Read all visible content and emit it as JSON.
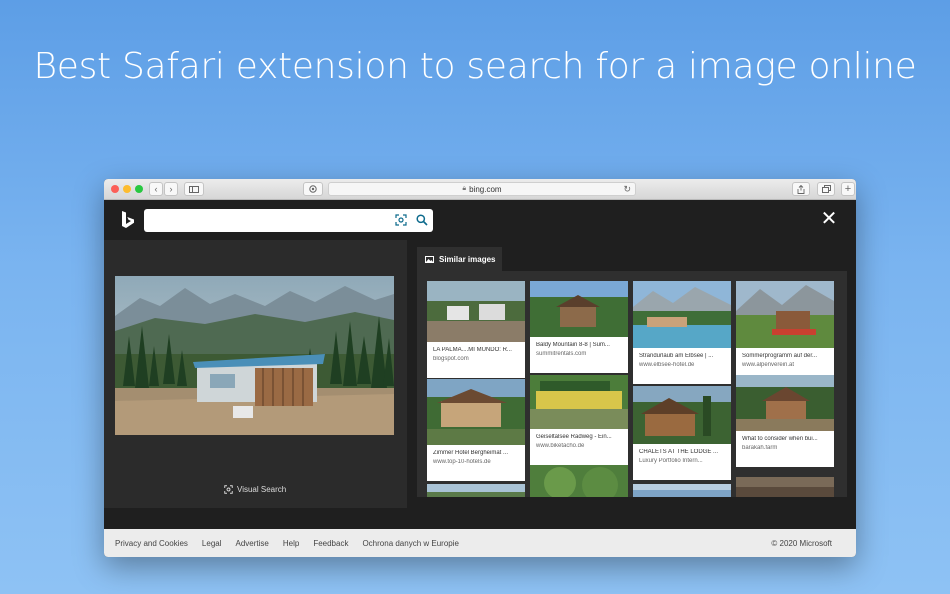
{
  "headline": "Best Safari extension to search for a image online",
  "browser": {
    "url": "bing.com"
  },
  "bing": {
    "search_placeholder": "",
    "visual_search_label": "Visual Search",
    "similar_tab_label": "Similar images"
  },
  "results": [
    {
      "title": "LA PALMA....MI MUNDO: R...",
      "domain": "blogspot.com"
    },
    {
      "title": "Baldy Mountain 8-8 | Sum...",
      "domain": "summitrentals.com"
    },
    {
      "title": "Strandurlaub am Elbsee | ...",
      "domain": "www.elbsee-hotel.de"
    },
    {
      "title": "Sommerprogramm auf der...",
      "domain": "www.alpenverein.at"
    },
    {
      "title": "Zimmer Hotel Bergheimat ...",
      "domain": "www.top-10-hotels.de"
    },
    {
      "title": "Geiseltalsee Radweg - Ein...",
      "domain": "www.biketacho.de"
    },
    {
      "title": "CHALETS AT THE LODGE ...",
      "domain": "Luxury Portfolio Intern..."
    },
    {
      "title": "What to consider when bui...",
      "domain": "barakah.farm"
    }
  ],
  "footer": {
    "links": [
      "Privacy and Cookies",
      "Legal",
      "Advertise",
      "Help",
      "Feedback",
      "Ochrona danych w Europie"
    ],
    "copyright": "© 2020 Microsoft"
  },
  "colors": {
    "background_top": "#5d9ee6",
    "background_bottom": "#8ec2f4",
    "bing_dark": "#1f1f1f",
    "panel": "#2b2b2b",
    "accent_blue": "#0078d4"
  }
}
